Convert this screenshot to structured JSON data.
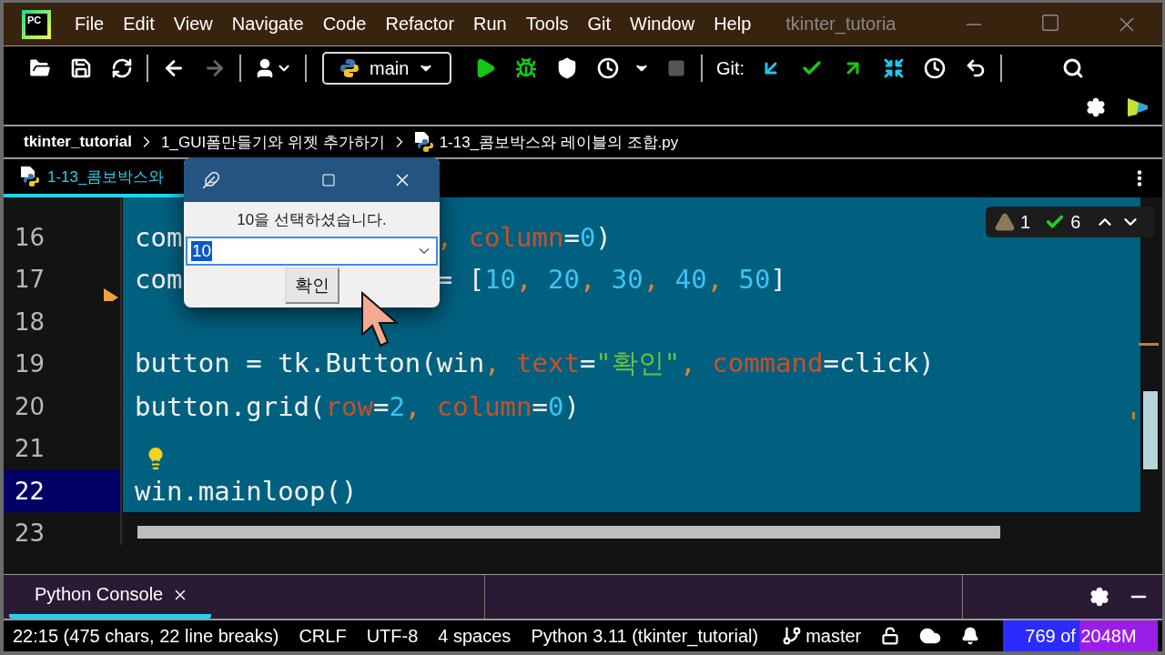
{
  "window": {
    "title": "tkinter_tutoria",
    "logo_text": "PC"
  },
  "menu": [
    {
      "label": "File"
    },
    {
      "label": "Edit"
    },
    {
      "label": "View"
    },
    {
      "label": "Navigate"
    },
    {
      "label": "Code"
    },
    {
      "label": "Refactor"
    },
    {
      "label": "Run"
    },
    {
      "label": "Tools"
    },
    {
      "label": "Git"
    },
    {
      "label": "Window"
    },
    {
      "label": "Help"
    }
  ],
  "toolbar": {
    "run_config": "main",
    "git_label": "Git:",
    "forward_disabled": true,
    "stop_disabled": true
  },
  "breadcrumb": [
    {
      "label": "tkinter_tutorial",
      "kind": "project"
    },
    {
      "label": "1_GUI폼만들기와 위젯 추가하기",
      "kind": "folder"
    },
    {
      "label": "1-13_콤보박스와 레이블의 조합.py",
      "kind": "file"
    }
  ],
  "editor_tabs": [
    {
      "label": "1-13_콤보박스와",
      "selected": true
    }
  ],
  "editor": {
    "inspections": {
      "warnings": "1",
      "typos": "6"
    },
    "lines": [
      {
        "selected": true,
        "current": false
      },
      {
        "number": "16",
        "selected": true,
        "current": false,
        "tokens": [
          {
            "text": "com",
            "kind": "plain"
          }
        ],
        "tokens_right": [
          {
            "text": ",",
            "kind": "comma"
          },
          {
            "text": " column",
            "kind": "param"
          },
          {
            "text": "=",
            "kind": "plain"
          },
          {
            "text": "0",
            "kind": "number"
          },
          {
            "text": ")",
            "kind": "plain"
          }
        ]
      },
      {
        "number": "17",
        "selected": true,
        "current": false,
        "marker": true,
        "tokens": [
          {
            "text": "com",
            "kind": "plain"
          }
        ],
        "tokens_right": [
          {
            "text": "= [",
            "kind": "plain"
          },
          {
            "text": "10",
            "kind": "number"
          },
          {
            "text": ",",
            "kind": "comma"
          },
          {
            "text": " 20",
            "kind": "number"
          },
          {
            "text": ",",
            "kind": "comma"
          },
          {
            "text": " 30",
            "kind": "number"
          },
          {
            "text": ",",
            "kind": "comma"
          },
          {
            "text": " 40",
            "kind": "number"
          },
          {
            "text": ",",
            "kind": "comma"
          },
          {
            "text": " 50",
            "kind": "number"
          },
          {
            "text": "]",
            "kind": "plain"
          }
        ]
      },
      {
        "number": "18",
        "selected": true,
        "current": false
      },
      {
        "number": "19",
        "selected": true,
        "current": false,
        "tokens": [
          {
            "text": "button = tk.Button(win",
            "kind": "plain"
          },
          {
            "text": ",",
            "kind": "comma"
          },
          {
            "text": " text",
            "kind": "param"
          },
          {
            "text": "=",
            "kind": "plain"
          },
          {
            "text": "\"확인\"",
            "kind": "string"
          },
          {
            "text": ",",
            "kind": "comma"
          },
          {
            "text": " command",
            "kind": "param"
          },
          {
            "text": "=click)",
            "kind": "plain"
          }
        ]
      },
      {
        "number": "20",
        "selected": true,
        "current": false,
        "tokens": [
          {
            "text": "button.grid(",
            "kind": "plain"
          },
          {
            "text": "row",
            "kind": "param"
          },
          {
            "text": "=",
            "kind": "plain"
          },
          {
            "text": "2",
            "kind": "number"
          },
          {
            "text": ",",
            "kind": "comma"
          },
          {
            "text": " column",
            "kind": "param"
          },
          {
            "text": "=",
            "kind": "plain"
          },
          {
            "text": "0",
            "kind": "number"
          },
          {
            "text": ")",
            "kind": "plain"
          }
        ]
      },
      {
        "number": "21",
        "selected": true,
        "current": false,
        "intention": true
      },
      {
        "number": "22",
        "selected": true,
        "current": true,
        "tokens": [
          {
            "text": "win.mainloop()",
            "kind": "plain"
          }
        ]
      },
      {
        "number": "23",
        "selected": false,
        "current": false
      }
    ]
  },
  "dialog": {
    "message": "10을 선택하셨습니다.",
    "combo_value": "10",
    "button": "확인"
  },
  "tool_window": {
    "tabs": [
      {
        "label": "Python Console",
        "selected": true
      }
    ]
  },
  "status_bar": {
    "items": [
      "22:15 (475 chars, 22 line breaks)",
      "CRLF",
      "UTF-8",
      "4 spaces",
      "Python 3.11 (tkinter_tutorial)"
    ],
    "branch": "master",
    "memory": {
      "text": "769 of 2048M",
      "level": 0.49
    }
  }
}
